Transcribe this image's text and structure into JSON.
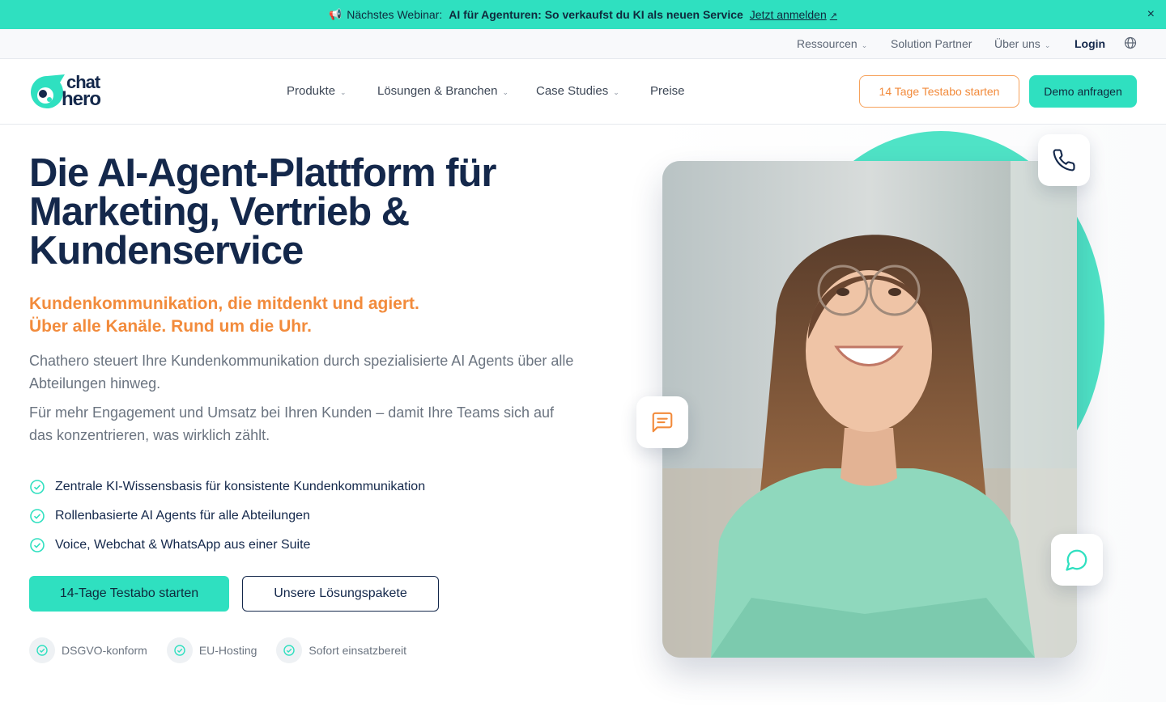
{
  "announcement": {
    "icon": "megaphone-icon",
    "prefix": "Nächstes Webinar:",
    "title": "AI für Agenturen: So verkaufst du KI als neuen Service",
    "link_label": "Jetzt anmelden",
    "close_label": "×"
  },
  "utility_nav": {
    "resources": "Ressourcen",
    "partner": "Solution Partner",
    "about": "Über uns",
    "login": "Login"
  },
  "logo": {
    "line1": "chat",
    "line2": "hero"
  },
  "main_nav": {
    "products": "Produkte",
    "solutions": "Lösungen & Branchen",
    "cases": "Case Studies",
    "pricing": "Preise",
    "trial_button": "14 Tage Testabo starten",
    "demo_button": "Demo anfragen"
  },
  "hero": {
    "headline": "Die AI-Agent-Plattform für Marketing, Vertrieb & Kundenservice",
    "subline1": "Kundenkommunikation, die mitdenkt und agiert.",
    "subline2": "Über alle Kanäle. Rund um die Uhr.",
    "paragraph1": "Chathero steuert Ihre Kundenkommunikation durch spezialisierte AI Agents über alle Abteilungen hinweg.",
    "paragraph2": "Für mehr Engagement und Umsatz bei Ihren Kunden – damit Ihre Teams sich auf das konzentrieren, was wirklich zählt.",
    "checks": [
      "Zentrale KI-Wissensbasis für konsistente Kundenkommunikation",
      "Rollenbasierte AI Agents für alle Abteilungen",
      "Voice, Webchat & WhatsApp aus einer Suite"
    ],
    "cta_primary": "14-Tage Testabo starten",
    "cta_secondary": "Unsere Lösungspakete",
    "badges": [
      "DSGVO-konform",
      "EU-Hosting",
      "Sofort einsatzbereit"
    ]
  },
  "colors": {
    "accent": "#2fe0c0",
    "navy": "#14284b",
    "orange": "#f28b3c"
  }
}
